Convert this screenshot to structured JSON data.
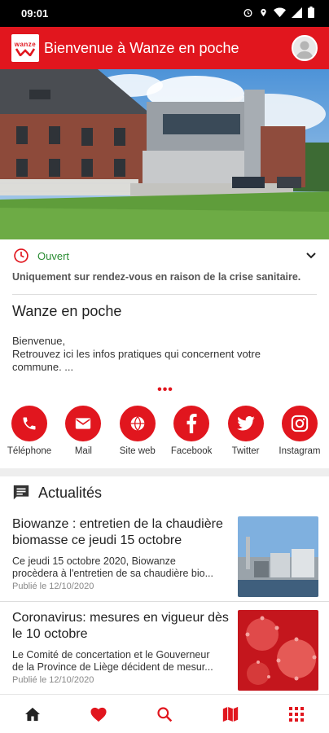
{
  "status_bar": {
    "time": "09:01"
  },
  "app_bar": {
    "title": "Bienvenue à Wanze en poche",
    "logo_text": "wanze"
  },
  "hours": {
    "status": "Ouvert",
    "note": "Uniquement sur rendez-vous en raison de la crise sanitaire."
  },
  "intro": {
    "title": "Wanze en poche",
    "line1": "Bienvenue,",
    "line2": "Retrouvez ici les infos pratiques qui concernent votre",
    "line3": "commune. ..."
  },
  "contacts": [
    {
      "label": "Téléphone",
      "icon": "phone-icon"
    },
    {
      "label": "Mail",
      "icon": "mail-icon"
    },
    {
      "label": "Site web",
      "icon": "globe-icon"
    },
    {
      "label": "Facebook",
      "icon": "facebook-icon"
    },
    {
      "label": "Twitter",
      "icon": "twitter-icon"
    },
    {
      "label": "Instagram",
      "icon": "instagram-icon"
    }
  ],
  "news": {
    "header": "Actualités",
    "items": [
      {
        "title": "Biowanze : entretien de la chaudière biomasse ce jeudi 15 octobre",
        "excerpt1": "Ce jeudi 15 octobre 2020, Biowanze",
        "excerpt2": "procèdera à l'entretien de sa chaudière bio...",
        "date": "Publié le 12/10/2020"
      },
      {
        "title": "Coronavirus: mesures en vigueur dès le 10 octobre",
        "excerpt1": "Le Comité de concertation et le Gouverneur",
        "excerpt2": "de la Province de Liège décident de mesur...",
        "date": "Publié le 12/10/2020"
      }
    ]
  },
  "bottom_nav": [
    "home-icon",
    "heart-icon",
    "search-icon",
    "map-icon",
    "grid-icon"
  ],
  "colors": {
    "brand": "#e1161e",
    "open": "#2a8c33"
  }
}
